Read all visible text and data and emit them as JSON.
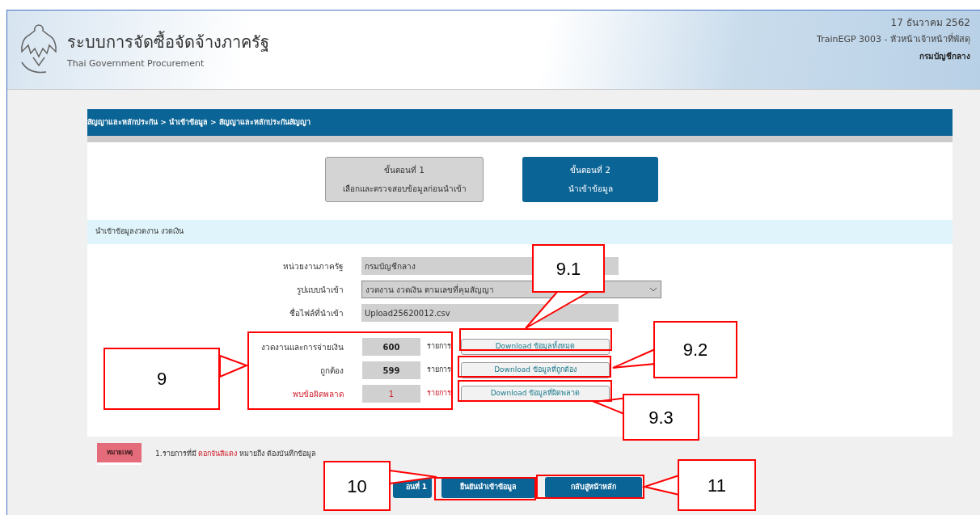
{
  "header": {
    "title": "ระบบการจัดซื้อจัดจ้างภาครัฐ",
    "subtitle": "Thai Government Procurement",
    "date": "17 ธันวาคม 2562",
    "user": "TrainEGP 3003 - หัวหน้าเจ้าหน้าที่พัสดุ",
    "department": "กรมบัญชีกลาง"
  },
  "breadcrumb": "สัญญาและหลักประกัน > นำเข้าข้อมูล > สัญญาและหลักประกันสัญญา",
  "steps": [
    {
      "title": "ขั้นตอนที่ 1",
      "description": "เลือกและตรวจสอบข้อมูลก่อนนำเข้า",
      "selected": false
    },
    {
      "title": "ขั้นตอนที่ 2",
      "description": "นำเข้าข้อมูล",
      "selected": true
    }
  ],
  "section_title": "นำเข้าข้อมูลงวดงาน งวดเงิน",
  "fields": [
    {
      "label": "หน่วยงานภาครัฐ",
      "value": "กรมบัญชีกลาง",
      "kind": "text"
    },
    {
      "label": "รูปแบบนำเข้า",
      "value": "งวดงาน งวดเงิน ตามเลขที่คุมสัญญา",
      "kind": "select"
    },
    {
      "label": "ชื่อไฟล์ที่นำเข้า",
      "value": "Upload25620012.csv",
      "kind": "text"
    }
  ],
  "counts": [
    {
      "label": "งวดงานและการจ่ายเงิน",
      "count": "600",
      "unit": "รายการ",
      "button": "Download ข้อมูลทั้งหมด",
      "kind": "normal"
    },
    {
      "label": "ถูกต้อง",
      "count": "599",
      "unit": "รายการ",
      "button": "Download ข้อมูลที่ถูกต้อง",
      "kind": "normal"
    },
    {
      "label": "พบข้อผิดพลาด",
      "count": "1",
      "unit": "รายการ",
      "button": "Download ข้อมูลที่ผิดพลาด",
      "kind": "error"
    }
  ],
  "note": {
    "badge": "หมายเหตุ",
    "before": "1.รายการที่มี",
    "highlight": "ดอกจันสีแดง",
    "after": "หมายถึง ต้องบันทึกข้อมูล"
  },
  "footer_buttons": [
    {
      "label": "อนที่ 1"
    },
    {
      "label": "ยืนยันนำเข้าข้อมูล"
    },
    {
      "label": "กลับสู่หน้าหลัก"
    }
  ],
  "annotations": [
    {
      "label": "9"
    },
    {
      "label": "9.1"
    },
    {
      "label": "9.2"
    },
    {
      "label": "9.3"
    },
    {
      "label": "10"
    },
    {
      "label": "11"
    }
  ]
}
